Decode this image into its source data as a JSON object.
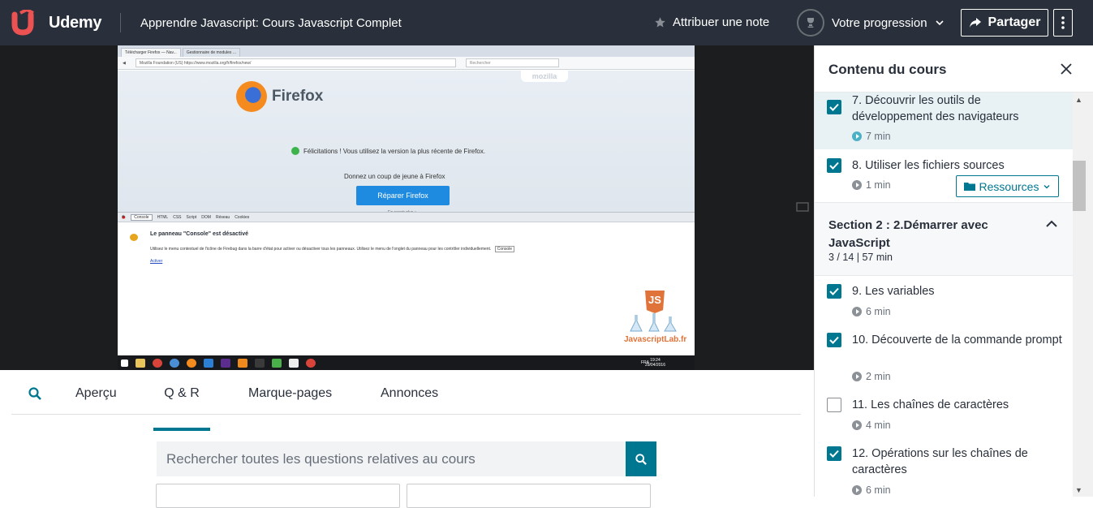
{
  "header": {
    "logo_text": "Udemy",
    "course_title": "Apprendre Javascript: Cours Javascript Complet",
    "rate_label": "Attribuer une note",
    "progress_label": "Votre progression",
    "share_label": "Partager"
  },
  "video": {
    "browser_tabs": [
      "Télécharger Firefox — Nav...",
      "Gestionnaire de modules ..."
    ],
    "url_text": "Mozilla Foundation (US)  https://www.mozilla.org/fr/firefox/new/",
    "search_placeholder": "Rechercher",
    "mozilla_tag": "mozilla",
    "firefox_name": "Firefox",
    "congrats": "Félicitations ! Vous utilisez la version la plus récente de Firefox.",
    "refresh_text": "Donnez un coup de jeune à Firefox",
    "refresh_button": "Réparer Firefox",
    "learn_more": "En savoir plus »",
    "firebug_tabs": [
      "Console",
      "HTML",
      "CSS",
      "Script",
      "DOM",
      "Réseau",
      "Cookies"
    ],
    "panel_title": "Le panneau \"Console\" est désactivé",
    "panel_text": "Utilisez le menu contextuel de l'icône de Firebug dans la barre d'état pour activer ou désactiver tous les panneaux. Utilisez le menu de l'onglet du panneau pour les contrôler individuellement.",
    "panel_console_chip": "Console",
    "panel_link": "Activer",
    "brand_name": "JavascriptLab.fr",
    "brand_js": "JS",
    "taskbar_lang": "FRA",
    "taskbar_time": "19:24",
    "taskbar_date": "29/04/2016"
  },
  "tabs": {
    "items": [
      "Aperçu",
      "Q & R",
      "Marque-pages",
      "Annonces"
    ],
    "active": "Q & R"
  },
  "qa": {
    "search_placeholder": "Rechercher toutes les questions relatives au cours"
  },
  "sidebar": {
    "title": "Contenu du cours",
    "lectures_top": [
      {
        "title": "7. Découvrir les outils de développement des navigateurs",
        "duration": "7 min",
        "checked": true
      },
      {
        "title": "8. Utiliser les fichiers sources",
        "duration": "1 min",
        "checked": true,
        "resources": "Ressources"
      }
    ],
    "section": {
      "title": "Section 2 : 2.Démarrer avec JavaScript",
      "meta": "3 / 14  |  57 min"
    },
    "lectures": [
      {
        "title": "9. Les variables",
        "duration": "6 min",
        "checked": true
      },
      {
        "title": "10. Découverte de la commande prompt",
        "duration": "2 min",
        "checked": true
      },
      {
        "title": "11. Les chaînes de caractères",
        "duration": "4 min",
        "checked": false
      },
      {
        "title": "12. Opérations sur les chaînes de caractères",
        "duration": "6 min",
        "checked": true
      }
    ]
  },
  "colors": {
    "topbar": "#29303b",
    "accent": "#007791",
    "brand": "#ec5252"
  }
}
